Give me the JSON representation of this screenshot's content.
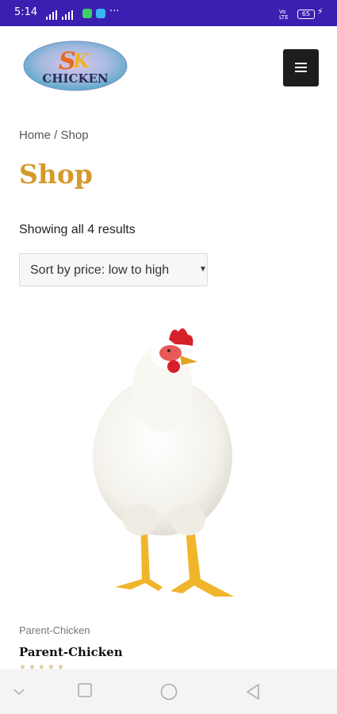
{
  "status_bar": {
    "time": "5:14",
    "battery": "65",
    "volte": "Vo\nLTE",
    "more": "···"
  },
  "logo": {
    "text": "CHICKEN",
    "monogram": "SK"
  },
  "header": {
    "menu_icon": "hamburger-icon"
  },
  "breadcrumb": {
    "home": "Home",
    "separator": " / ",
    "current": "Shop"
  },
  "page": {
    "title": "Shop",
    "results_text": "Showing all 4 results"
  },
  "sort": {
    "selected": "Sort by price: low to high",
    "caret": "▼"
  },
  "product": {
    "category": "Parent-Chicken",
    "name": "Parent-Chicken",
    "rating": 0,
    "stars": "★★★★★"
  },
  "nav": {
    "back": "back-icon",
    "home": "home-circle-icon",
    "recents": "recents-square-icon",
    "down": "chevron-down-icon"
  },
  "colors": {
    "status_bar": "#3a1fb0",
    "title": "#d49a2c",
    "menu_button": "#1d1d1d"
  }
}
